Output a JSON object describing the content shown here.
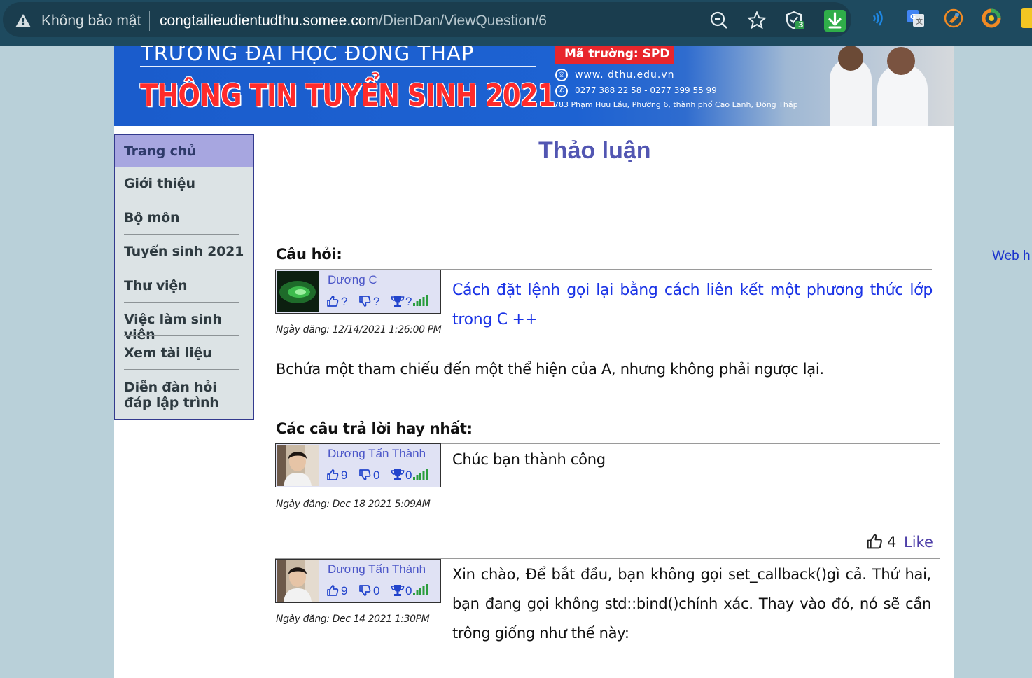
{
  "browser": {
    "security_label": "Không bảo mật",
    "url_host": "congtailieudientudthu.somee.com",
    "url_path": "/DienDan/ViewQuestion/6",
    "shield_badge": "3",
    "icons": [
      "zoom-out-icon",
      "star-icon",
      "shield-icon",
      "download-icon",
      "wifi-reader-icon",
      "translate-icon",
      "extension-icon",
      "colorzilla-icon"
    ]
  },
  "banner": {
    "university": "TRƯỜNG ĐẠI HỌC ĐỒNG THÁP",
    "title": "THÔNG TIN TUYỂN SINH 2021",
    "school_code": "Mã trường: SPD",
    "website": "www. dthu.edu.vn",
    "phone": "0277 388 22 58  -  0277 399 55 99",
    "address": "783 Phạm Hữu Lầu, Phường 6, thành phố Cao Lãnh, Đồng Tháp"
  },
  "nav": {
    "items": [
      {
        "label": "Trang chủ",
        "active": true
      },
      {
        "label": "Giới thiệu"
      },
      {
        "label": "Bộ môn"
      },
      {
        "label": "Tuyển sinh 2021"
      },
      {
        "label": "Thư viện"
      },
      {
        "label": "Việc làm sinh viên"
      },
      {
        "label": "Xem tài liệu"
      },
      {
        "label": "Diễn đàn hỏi đáp lập trình"
      }
    ]
  },
  "page_title": "Thảo luận",
  "question": {
    "heading": "Câu hỏi:",
    "author": "Dương C",
    "likes": "?",
    "dislikes": "?",
    "score": "?",
    "title": "Cách đặt lệnh gọi lại bằng cách liên kết một phương thức lớp trong C ++",
    "date": "Ngày đăng: 12/14/2021 1:26:00 PM",
    "body": "Bchứa một tham chiếu đến một thể hiện của A, nhưng không phải ngược lại."
  },
  "answers": {
    "heading": "Các câu trả lời hay nhất:",
    "items": [
      {
        "author": "Dương Tấn Thành",
        "likes": "9",
        "dislikes": "0",
        "score": "0",
        "date": "Ngày đăng: Dec 18 2021 5:09AM",
        "body": "Chúc bạn thành công",
        "like_count": "4",
        "like_label": "Like"
      },
      {
        "author": "Dương Tấn Thành",
        "likes": "9",
        "dislikes": "0",
        "score": "0",
        "date": "Ngày đăng: Dec 14 2021 1:30PM",
        "body": "Xin chào, Để bắt đầu, bạn không gọi set_callback()gì cả. Thứ hai, bạn đang gọi không std::bind()chính xác. Thay vào đó, nó sẽ cần trông giống như thế này:"
      }
    ]
  },
  "side_link": "Web h"
}
